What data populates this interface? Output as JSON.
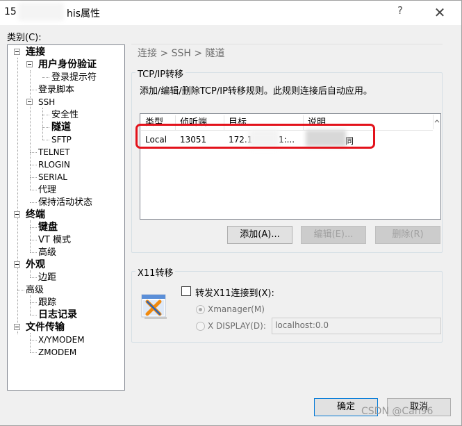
{
  "window": {
    "title_prefix": "15",
    "title_suffix": "his属性",
    "help_icon": "?",
    "close_icon": "✕"
  },
  "category_label": "类别(C):",
  "tree": {
    "connection": "连接",
    "user_auth": "用户身份验证",
    "login_prompt": "登录提示符",
    "login_script": "登录脚本",
    "ssh": "SSH",
    "security": "安全性",
    "tunnel": "隧道",
    "sftp": "SFTP",
    "telnet": "TELNET",
    "rlogin": "RLOGIN",
    "serial": "SERIAL",
    "proxy": "代理",
    "keepalive": "保持活动状态",
    "terminal": "终端",
    "keyboard": "键盘",
    "vt_mode": "VT 模式",
    "advanced1": "高级",
    "appearance": "外观",
    "margin": "边距",
    "advanced2": "高级",
    "trace": "跟踪",
    "log": "日志记录",
    "file_transfer": "文件传输",
    "xymodem": "X/YMODEM",
    "zmodem": "ZMODEM"
  },
  "breadcrumb": "连接 > SSH > 隧道",
  "tcp_group": {
    "label": "TCP/IP转移",
    "description": "添加/编辑/删除TCP/IP转移规则。此规则连接后自动应用。",
    "columns": [
      "类型",
      "侦听端...",
      "目标",
      "说明"
    ],
    "rows": [
      {
        "type": "Local",
        "listen_port": "13051",
        "target": "172.1",
        "target_tail": "1:...",
        "desc_tail": "同"
      }
    ],
    "add_button": "添加(A)...",
    "edit_button": "编辑(E)...",
    "delete_button": "删除(R)"
  },
  "x11_group": {
    "label": "X11转移",
    "forward_checkbox": "转发X11连接到(X):",
    "forward_checked": false,
    "radio_xmanager": "Xmanager(M)",
    "radio_display": "X DISPLAY(D):",
    "display_value": "localhost:0.0"
  },
  "buttons": {
    "ok": "确定",
    "cancel": "取消"
  },
  "watermark": "CSDN @Can96",
  "colors": {
    "highlight": "#e3121b",
    "accent": "#0078d7"
  }
}
